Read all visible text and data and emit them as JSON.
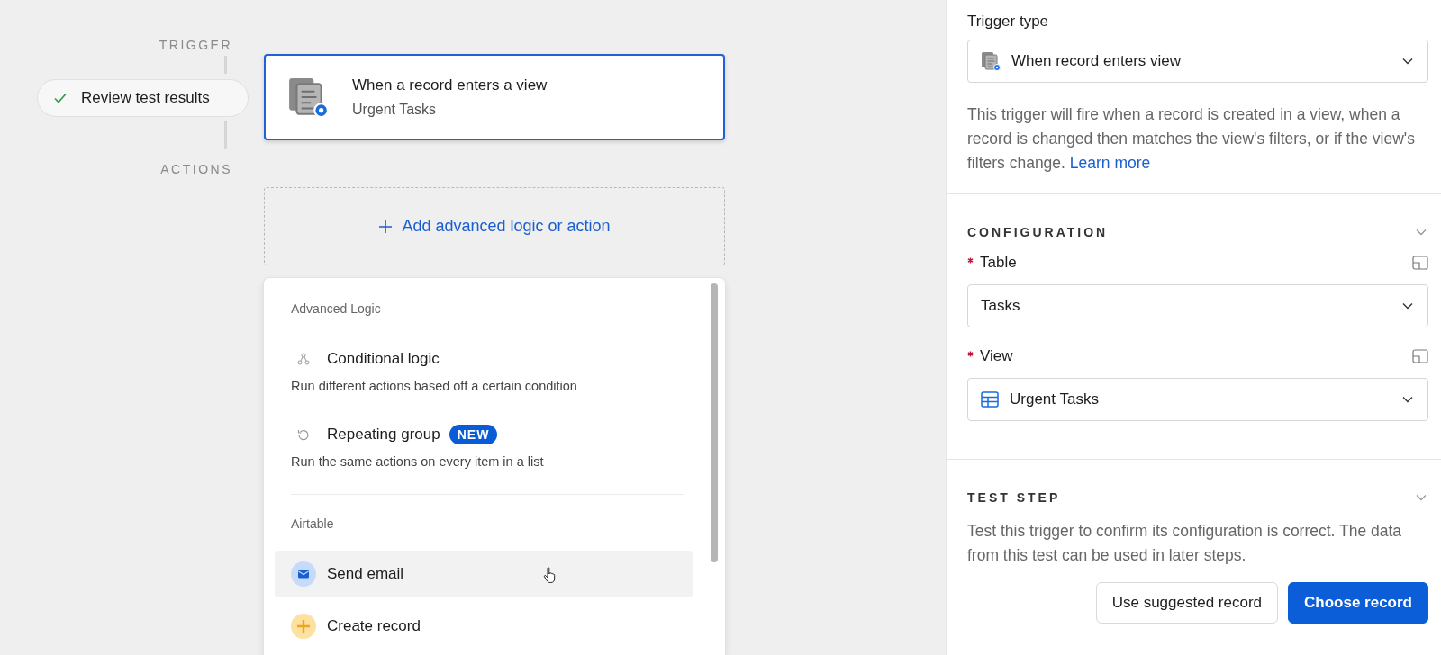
{
  "flow": {
    "trigger_label": "TRIGGER",
    "actions_label": "ACTIONS",
    "status_pill": {
      "label": "Review test results",
      "checked": true
    },
    "trigger_card": {
      "title": "When a record enters a view",
      "subtitle": "Urgent Tasks",
      "selected": true
    },
    "add_button": {
      "label": "Add advanced logic or action"
    }
  },
  "menu": {
    "sections": [
      {
        "heading": "Advanced Logic",
        "items": [
          {
            "kind": "conditional",
            "title": "Conditional logic",
            "description": "Run different actions based off a certain condition",
            "highlighted": false
          },
          {
            "kind": "repeat",
            "title": "Repeating group",
            "badge": "NEW",
            "description": "Run the same actions on every item in a list",
            "highlighted": false
          }
        ]
      },
      {
        "heading": "Airtable",
        "items": [
          {
            "kind": "email",
            "title": "Send email",
            "highlighted": true
          },
          {
            "kind": "create",
            "title": "Create record",
            "highlighted": false
          }
        ]
      }
    ]
  },
  "panel": {
    "trigger_type": {
      "label": "Trigger type",
      "value": "When record enters view",
      "description": "This trigger will fire when a record is created in a view, when a record is changed then matches the view's filters, or if the view's filters change.",
      "link": "Learn more"
    },
    "configuration": {
      "heading": "CONFIGURATION",
      "expanded": true,
      "fields": [
        {
          "label": "Table",
          "required": true,
          "kind": "table",
          "value": "Tasks"
        },
        {
          "label": "View",
          "required": true,
          "kind": "view",
          "value": "Urgent Tasks"
        }
      ]
    },
    "test_step": {
      "heading": "TEST STEP",
      "expanded": true,
      "description": "Test this trigger to confirm its configuration is correct. The data from this test can be used in later steps.",
      "buttons": [
        {
          "label": "Use suggested record",
          "kind": "secondary"
        },
        {
          "label": "Choose record",
          "kind": "primary"
        }
      ]
    }
  }
}
